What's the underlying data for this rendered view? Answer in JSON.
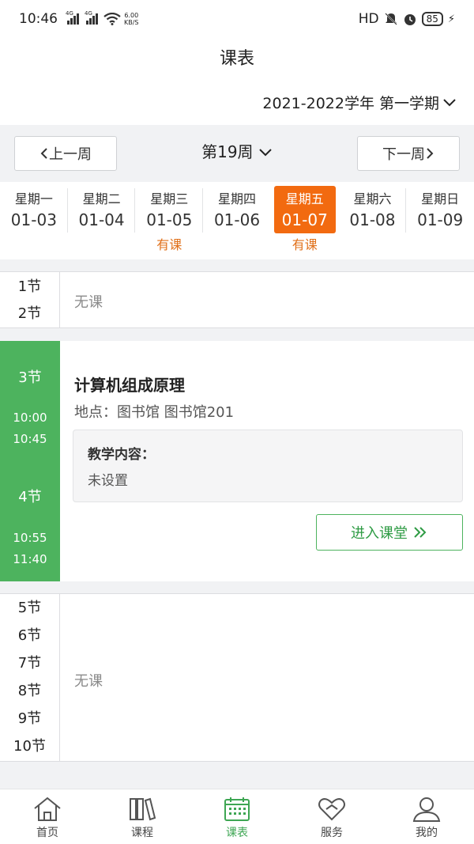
{
  "status": {
    "time": "10:46",
    "net1": "4G",
    "net2": "4G",
    "speed_top": "6.00",
    "speed_bottom": "KB/S",
    "hd": "HD",
    "battery": "85"
  },
  "header": {
    "title": "课表",
    "term": "2021-2022学年 第一学期"
  },
  "weeknav": {
    "prev": "上一周",
    "week": "第19周",
    "next": "下一周"
  },
  "days": [
    {
      "name": "星期一",
      "date": "01-03",
      "mark": ""
    },
    {
      "name": "星期二",
      "date": "01-04",
      "mark": ""
    },
    {
      "name": "星期三",
      "date": "01-05",
      "mark": "有课"
    },
    {
      "name": "星期四",
      "date": "01-06",
      "mark": ""
    },
    {
      "name": "星期五",
      "date": "01-07",
      "mark": "有课"
    },
    {
      "name": "星期六",
      "date": "01-08",
      "mark": ""
    },
    {
      "name": "星期日",
      "date": "01-09",
      "mark": ""
    }
  ],
  "colors": {
    "accent": "#4db35e",
    "today": "#f26a10",
    "mark": "#e0701a"
  },
  "schedule": {
    "block1": {
      "periods": [
        "1节",
        "2节"
      ],
      "empty": "无课"
    },
    "block2": {
      "p1": "3节",
      "t1a": "10:00",
      "t1b": "10:45",
      "p2": "4节",
      "t2a": "10:55",
      "t2b": "11:40",
      "course": "计算机组成原理",
      "location": "地点：图书馆 图书馆201",
      "content_title": "教学内容：",
      "content_value": "未设置",
      "enter": "进入课堂"
    },
    "block3": {
      "periods": [
        "5节",
        "6节",
        "7节",
        "8节",
        "9节",
        "10节"
      ],
      "empty": "无课"
    }
  },
  "tabs": [
    {
      "label": "首页",
      "icon": "home-icon"
    },
    {
      "label": "课程",
      "icon": "books-icon"
    },
    {
      "label": "课表",
      "icon": "calendar-icon"
    },
    {
      "label": "服务",
      "icon": "heart-icon"
    },
    {
      "label": "我的",
      "icon": "user-icon"
    }
  ]
}
